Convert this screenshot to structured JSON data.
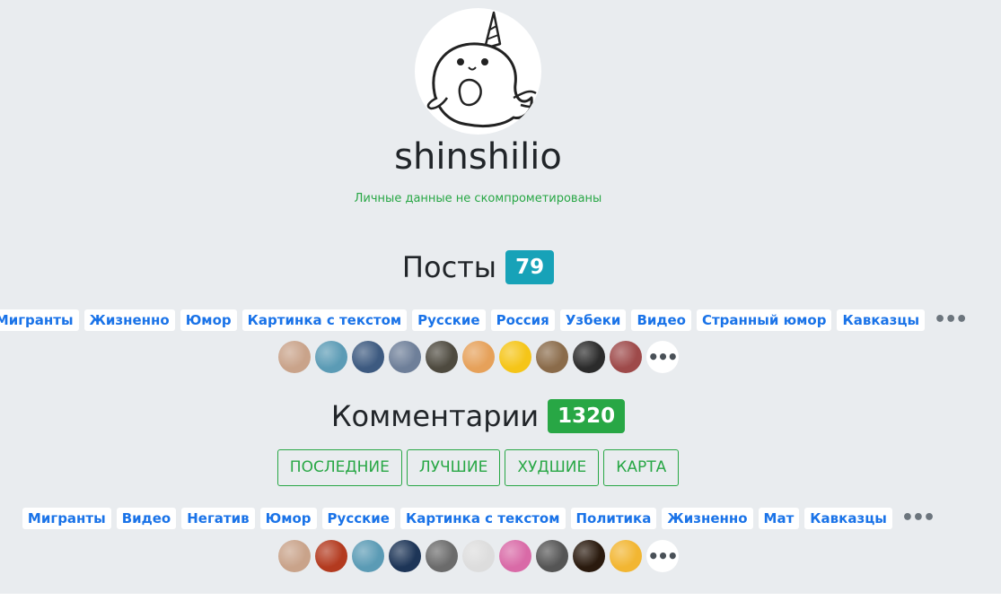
{
  "profile": {
    "username": "shinshilio",
    "privacy_status": "Личные данные не скомпрометированы"
  },
  "posts": {
    "title": "Посты",
    "count": "79",
    "tags": [
      "Мигранты",
      "Жизненно",
      "Юмор",
      "Картинка с текстом",
      "Русские",
      "Россия",
      "Узбеки",
      "Видео",
      "Странный юмор",
      "Кавказцы"
    ],
    "more": "•••",
    "communities": [
      "#c9a38a",
      "#5b9bb5",
      "#3d5a80",
      "#6e7f99",
      "#4e4a3f",
      "#e6a15a",
      "#f5c518",
      "#8a6b4a",
      "#2b2b2b",
      "#9e4a4a"
    ],
    "communities_more": "•••"
  },
  "comments": {
    "title": "Комментарии",
    "count": "1320",
    "filters": [
      "ПОСЛЕДНИЕ",
      "ЛУЧШИЕ",
      "ХУДШИЕ",
      "КАРТА"
    ],
    "tags": [
      "Мигранты",
      "Видео",
      "Негатив",
      "Юмор",
      "Русские",
      "Картинка с текстом",
      "Политика",
      "Жизненно",
      "Мат",
      "Кавказцы"
    ],
    "more": "•••",
    "communities": [
      "#c9a38a",
      "#b33a1f",
      "#5b9bb5",
      "#1d3557",
      "#6b6b6b",
      "#dddddd",
      "#d96aa7",
      "#555555",
      "#2a1a0e",
      "#f2b632"
    ],
    "communities_more": "•••"
  },
  "colors": {
    "background": "#e9ecef",
    "accent_blue": "#1a73e8",
    "badge_teal": "#17a2b8",
    "badge_green": "#28a745"
  }
}
